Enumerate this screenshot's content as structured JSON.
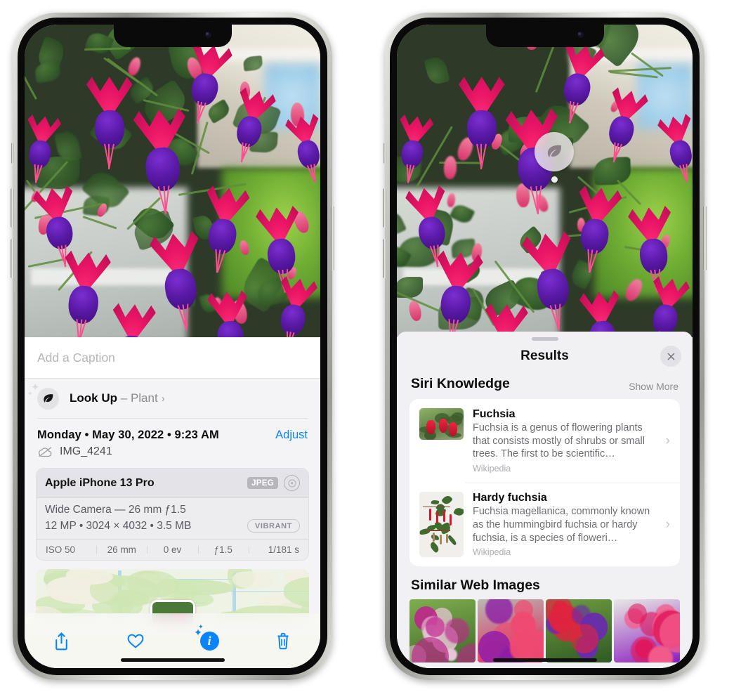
{
  "left_phone": {
    "caption_field": {
      "placeholder": "Add a Caption",
      "value": ""
    },
    "lookup": {
      "label": "Look Up",
      "dash": "–",
      "subject": "Plant",
      "chevron": "›",
      "icon": "leaf-icon"
    },
    "date_line": "Monday • May 30, 2022 • 9:23 AM",
    "adjust_label": "Adjust",
    "filename": "IMG_4241",
    "cloud_icon": "cloud-slash-icon",
    "metadata": {
      "device": "Apple iPhone 13 Pro",
      "format_badge": "JPEG",
      "aperture_icon": "aperture-icon",
      "lens_line": "Wide Camera — 26 mm ƒ1.5",
      "spec_line": "12 MP • 3024 × 4032 • 3.5 MB",
      "style_badge": "VIBRANT",
      "exif": [
        "ISO 50",
        "26 mm",
        "0 ev",
        "ƒ1.5",
        "1/181 s"
      ]
    },
    "toolbar": {
      "share_label": "share-icon",
      "favorite_label": "heart-icon",
      "info_label": "info-icon",
      "delete_label": "trash-icon",
      "info_glyph": "i"
    }
  },
  "right_phone": {
    "visual_lookup_badge": {
      "icon": "leaf-icon"
    },
    "sheet": {
      "title": "Results",
      "close_label": "×",
      "sections": [
        {
          "title": "Siri Knowledge",
          "action": "Show More",
          "results": [
            {
              "title": "Fuchsia",
              "description": "Fuchsia is a genus of flowering plants that consists mostly of shrubs or small trees. The first to be scientific…",
              "source": "Wikipedia",
              "chevron": "›"
            },
            {
              "title": "Hardy fuchsia",
              "description": "Fuchsia magellanica, commonly known as the hummingbird fuchsia or hardy fuchsia, is a species of floweri…",
              "source": "Wikipedia",
              "chevron": "›"
            }
          ]
        },
        {
          "title": "Similar Web Images",
          "images": [
            "fuchsia-web-image-1",
            "fuchsia-web-image-2",
            "fuchsia-web-image-3",
            "fuchsia-web-image-4"
          ]
        }
      ]
    }
  },
  "colors": {
    "accent_blue": "#0a84ff",
    "sheet_bg": "#f1f1f4",
    "card_bg": "#ffffff",
    "secondary_text": "#8a8a8f"
  }
}
